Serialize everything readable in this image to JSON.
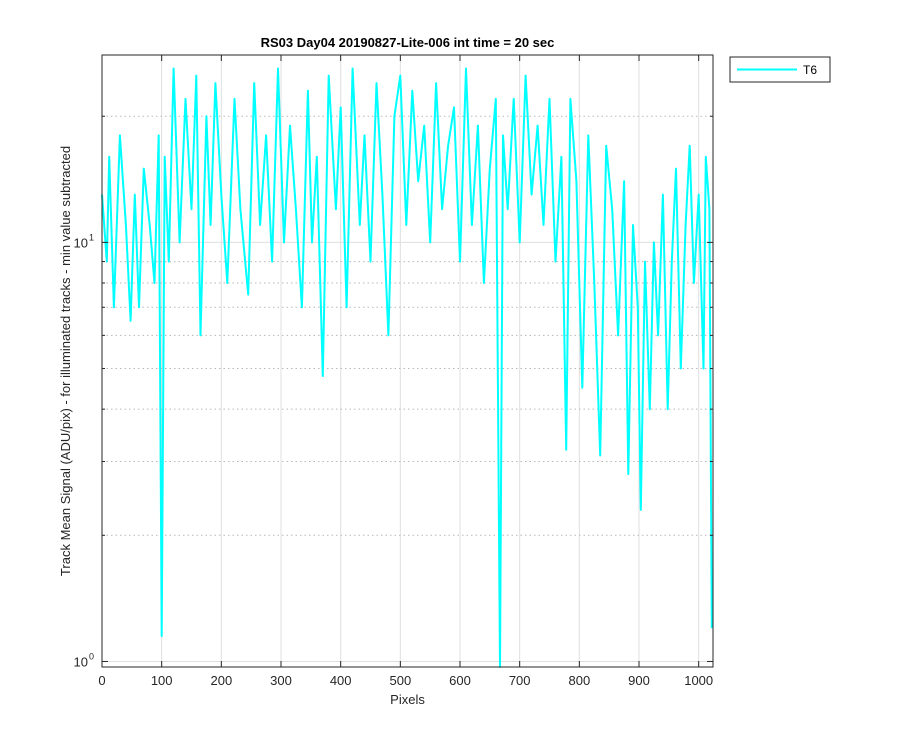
{
  "chart_data": {
    "type": "line",
    "title": "RS03 Day04 20190827-Lite-006 int time = 20 sec",
    "xlabel": "Pixels",
    "ylabel": "Track Mean Signal (ADU/pix) - for illuminated tracks - min value subtracted",
    "xlim": [
      0,
      1024
    ],
    "ylim": [
      0.97,
      28
    ],
    "yscale": "log",
    "grid": true,
    "legend_position": "outside-top-right",
    "x_ticks": [
      0,
      100,
      200,
      300,
      400,
      500,
      600,
      700,
      800,
      900,
      1000
    ],
    "x_tick_labels": [
      "0",
      "100",
      "200",
      "300",
      "400",
      "500",
      "600",
      "700",
      "800",
      "900",
      "1000"
    ],
    "y_major_ticks": [
      1,
      10
    ],
    "y_tick_labels": [
      {
        "base": "10",
        "exp": "0",
        "value": 1
      },
      {
        "base": "10",
        "exp": "1",
        "value": 10
      }
    ],
    "y_minor_ticks": [
      2,
      3,
      4,
      5,
      6,
      7,
      8,
      9,
      20
    ],
    "series": [
      {
        "name": "T6",
        "color": "#00FFFF",
        "x": [
          0,
          8,
          12,
          20,
          30,
          40,
          48,
          55,
          62,
          70,
          80,
          88,
          95,
          100,
          105,
          112,
          120,
          130,
          140,
          150,
          158,
          165,
          175,
          182,
          190,
          200,
          210,
          222,
          232,
          245,
          255,
          265,
          275,
          285,
          295,
          305,
          315,
          325,
          335,
          345,
          352,
          360,
          370,
          380,
          392,
          400,
          410,
          420,
          432,
          440,
          450,
          460,
          470,
          480,
          490,
          500,
          510,
          520,
          530,
          540,
          550,
          560,
          570,
          580,
          590,
          600,
          610,
          620,
          630,
          640,
          650,
          660,
          667,
          672,
          680,
          690,
          700,
          710,
          720,
          730,
          740,
          750,
          760,
          770,
          778,
          785,
          795,
          805,
          815,
          825,
          835,
          845,
          855,
          865,
          875,
          882,
          890,
          898,
          903,
          910,
          918,
          925,
          932,
          940,
          948,
          955,
          962,
          970,
          978,
          985,
          992,
          1000,
          1008,
          1012,
          1018,
          1022
        ],
        "values": [
          13,
          9,
          16,
          7,
          18,
          11,
          6.5,
          13,
          7,
          15,
          11,
          8,
          18,
          1.15,
          16,
          9,
          26,
          10,
          22,
          12,
          25,
          6,
          20,
          11,
          24,
          13,
          8,
          22,
          12,
          7.5,
          24,
          11,
          18,
          9,
          26,
          10,
          19,
          12,
          7,
          23,
          10,
          16,
          4.8,
          25,
          12,
          21,
          7,
          26,
          11,
          18,
          9,
          24,
          13,
          6,
          20,
          25,
          11,
          23,
          14,
          19,
          10,
          24,
          12,
          17,
          21,
          9,
          26,
          11,
          19,
          8,
          15,
          22,
          0.97,
          18,
          12,
          22,
          10,
          25,
          13,
          19,
          11,
          22,
          9,
          16,
          3.2,
          22,
          14,
          4.5,
          18,
          8,
          3.1,
          17,
          12,
          6,
          14,
          2.8,
          11,
          7,
          2.3,
          9,
          4,
          10,
          6,
          13,
          4,
          9,
          15,
          5,
          11,
          17,
          8,
          13,
          5,
          16,
          12,
          1.2
        ]
      }
    ]
  }
}
